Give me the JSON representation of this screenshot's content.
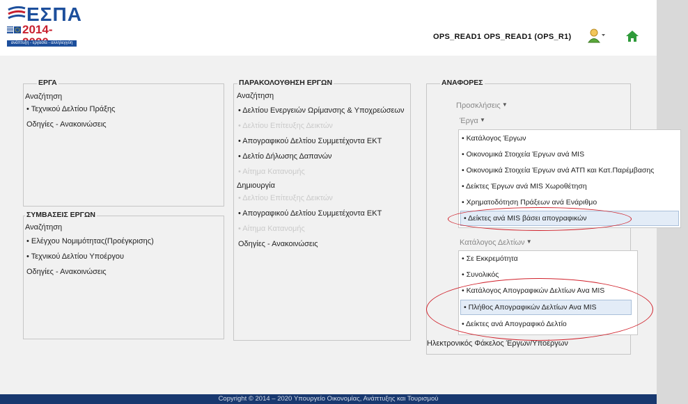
{
  "header": {
    "logo_title": "ΕΣΠΑ",
    "logo_years": "2014-2020",
    "logo_tagline": "ανάπτυξη - εργασία - αλληλεγγύη",
    "user": "OPS_READ1 OPS_READ1 (OPS_R1)"
  },
  "erga": {
    "title": "ΕΡΓΑ",
    "search_label": "Αναζήτηση",
    "items": [
      "• Τεχνικού Δελτίου Πράξης"
    ],
    "announcements": "Οδηγίες - Ανακοινώσεις"
  },
  "symvaseis": {
    "title": "ΣΥΜΒΑΣΕΙΣ ΕΡΓΩΝ",
    "search_label": "Αναζήτηση",
    "items": [
      "• Ελέγχου Νομιμότητας(Προέγκρισης)",
      "• Τεχνικού Δελτίου Υποέργου"
    ],
    "announcements": "Οδηγίες - Ανακοινώσεις"
  },
  "parakolouthisi": {
    "title": "ΠΑΡΑΚΟΛΟΥΘΗΣΗ ΕΡΓΩΝ",
    "search_label": "Αναζήτηση",
    "search_items": [
      "• Δελτίου Ενεργειών Ωρίμανσης & Υποχρεώσεων",
      "• Δελτίου Επίτευξης Δεικτών",
      "• Απογραφικού Δελτίου Συμμετέχοντα ΕΚΤ",
      "• Δελτίο Δήλωσης Δαπανών",
      "• Αίτημα Κατανομής"
    ],
    "create_label": "Δημιουργία",
    "create_items": [
      "• Δελτίου Επίτευξης Δεικτών",
      "• Απογραφικού Δελτίου Συμμετέχοντα ΕΚΤ",
      "• Αίτημα Κατανομής"
    ],
    "announcements": "Οδηγίες - Ανακοινώσεις"
  },
  "anafores": {
    "title": "ΑΝΑΦΟΡΕΣ",
    "proskliseis": "Προσκλήσεις",
    "erga": "Έργα",
    "erga_menu": [
      "• Κατάλογος Έργων",
      "• Οικονομικά Στοιχεία Έργων ανά MIS",
      "• Οικονομικά Στοιχεία Έργων ανά ΑΤΠ και Κατ.Παρέμβασης",
      "• Δείκτες Έργων ανά MIS Χωροθέτηση",
      "• Χρηματοδότηση Πράξεων ανά Ενάριθμο",
      "• Δείκτες ανά MIS βάσει απογραφικών"
    ],
    "katalogos": "Κατάλογος Δελτίων",
    "katalogos_menu": [
      "• Σε Εκκρεμότητα",
      "• Συνολικός",
      "• Κατάλογος Απογραφικών Δελτίων Ανα MIS",
      "• Πλήθος Απογραφικών Δελτίων Ανα MIS",
      "• Δείκτες ανά Απογραφικό Δελτίο"
    ],
    "folder": "Ηλεκτρονικός Φάκελος Έργων/Υποέργων"
  },
  "footer": {
    "text": "Copyright © 2014 – 2020 Υπουργείο Οικονομίας, Ανάπτυξης και Τουρισμού"
  },
  "colors": {
    "brand_blue": "#1d4f9c",
    "brand_red": "#c8202f",
    "footer_bg": "#18386f",
    "highlight_oval": "#d0202a"
  }
}
